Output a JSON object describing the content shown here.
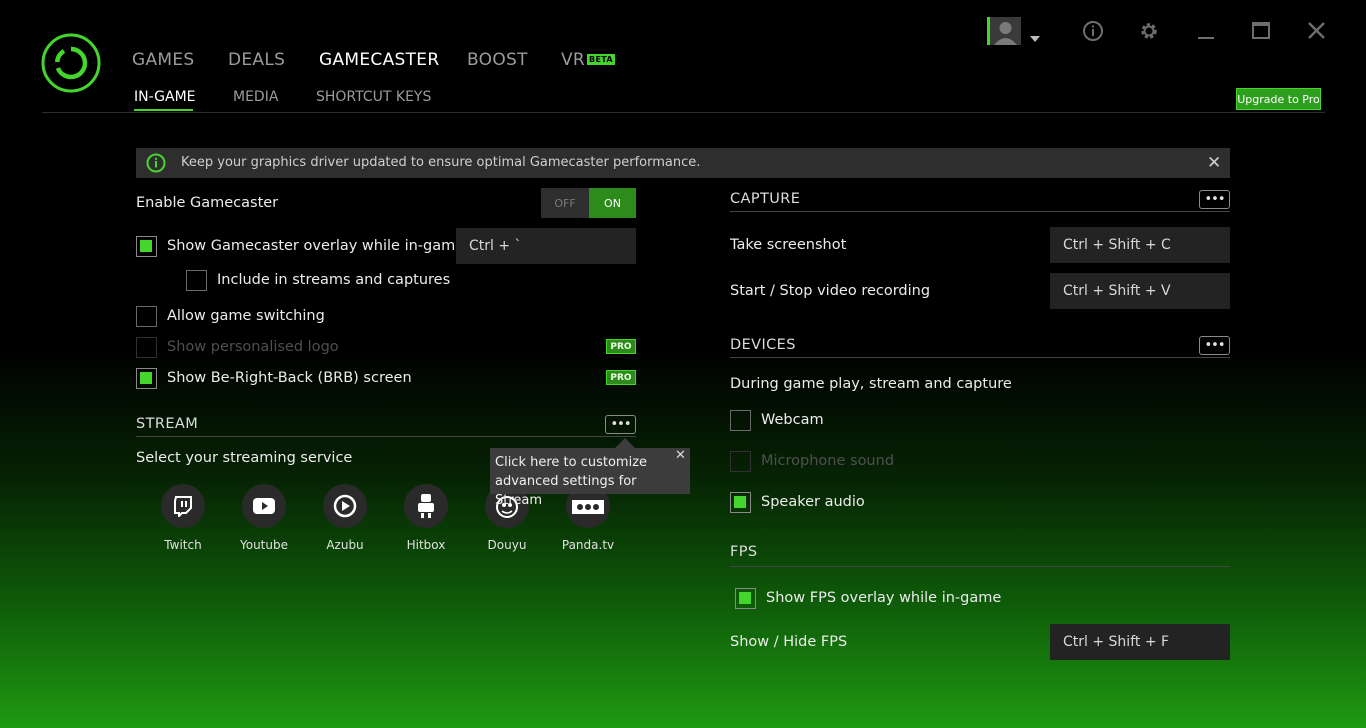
{
  "nav": {
    "items": [
      {
        "label": "GAMES"
      },
      {
        "label": "DEALS"
      },
      {
        "label": "GAMECASTER"
      },
      {
        "label": "BOOST"
      },
      {
        "label": "VR"
      }
    ],
    "vr_badge": "BETA",
    "sub_items": [
      {
        "label": "IN-GAME"
      },
      {
        "label": "MEDIA"
      },
      {
        "label": "SHORTCUT KEYS"
      }
    ],
    "upgrade_label": "Upgrade to Pro"
  },
  "window_controls": {
    "info_icon": "info-icon",
    "settings_icon": "gear-icon",
    "minimize": "—",
    "maximize": "▭",
    "close": "✕"
  },
  "banner": {
    "text": "Keep your graphics driver updated to ensure optimal Gamecaster performance.",
    "close": "✕"
  },
  "left": {
    "enable_label": "Enable Gamecaster",
    "toggle_off": "OFF",
    "toggle_on": "ON",
    "overlay_label": "Show Gamecaster overlay while in-game",
    "overlay_key": "Ctrl + `",
    "include_label": "Include in streams and captures",
    "switching_label": "Allow game switching",
    "logo_label": "Show personalised logo",
    "brb_label": "Show Be-Right-Back (BRB) screen",
    "pro_badge": "PRO"
  },
  "stream": {
    "title": "STREAM",
    "more": "•••",
    "select_label": "Select your streaming service",
    "services": [
      {
        "label": "Twitch"
      },
      {
        "label": "Youtube"
      },
      {
        "label": "Azubu"
      },
      {
        "label": "Hitbox"
      },
      {
        "label": "Douyu"
      },
      {
        "label": "Panda.tv"
      }
    ],
    "tooltip_line1": "Click here to customize",
    "tooltip_line2": "advanced settings for Stream",
    "tooltip_close": "✕"
  },
  "capture": {
    "title": "CAPTURE",
    "more": "•••",
    "screenshot_label": "Take screenshot",
    "screenshot_key": "Ctrl + Shift + C",
    "record_label": "Start / Stop video recording",
    "record_key": "Ctrl + Shift + V"
  },
  "devices": {
    "title": "DEVICES",
    "more": "•••",
    "desc": "During game play, stream and capture",
    "webcam_label": "Webcam",
    "mic_label": "Microphone sound",
    "speaker_label": "Speaker audio"
  },
  "fps": {
    "title": "FPS",
    "overlay_label": "Show FPS overlay while in-game",
    "toggle_label": "Show / Hide FPS",
    "toggle_key": "Ctrl + Shift + F"
  },
  "colors": {
    "accent": "#44d62c",
    "background": "#000000"
  }
}
